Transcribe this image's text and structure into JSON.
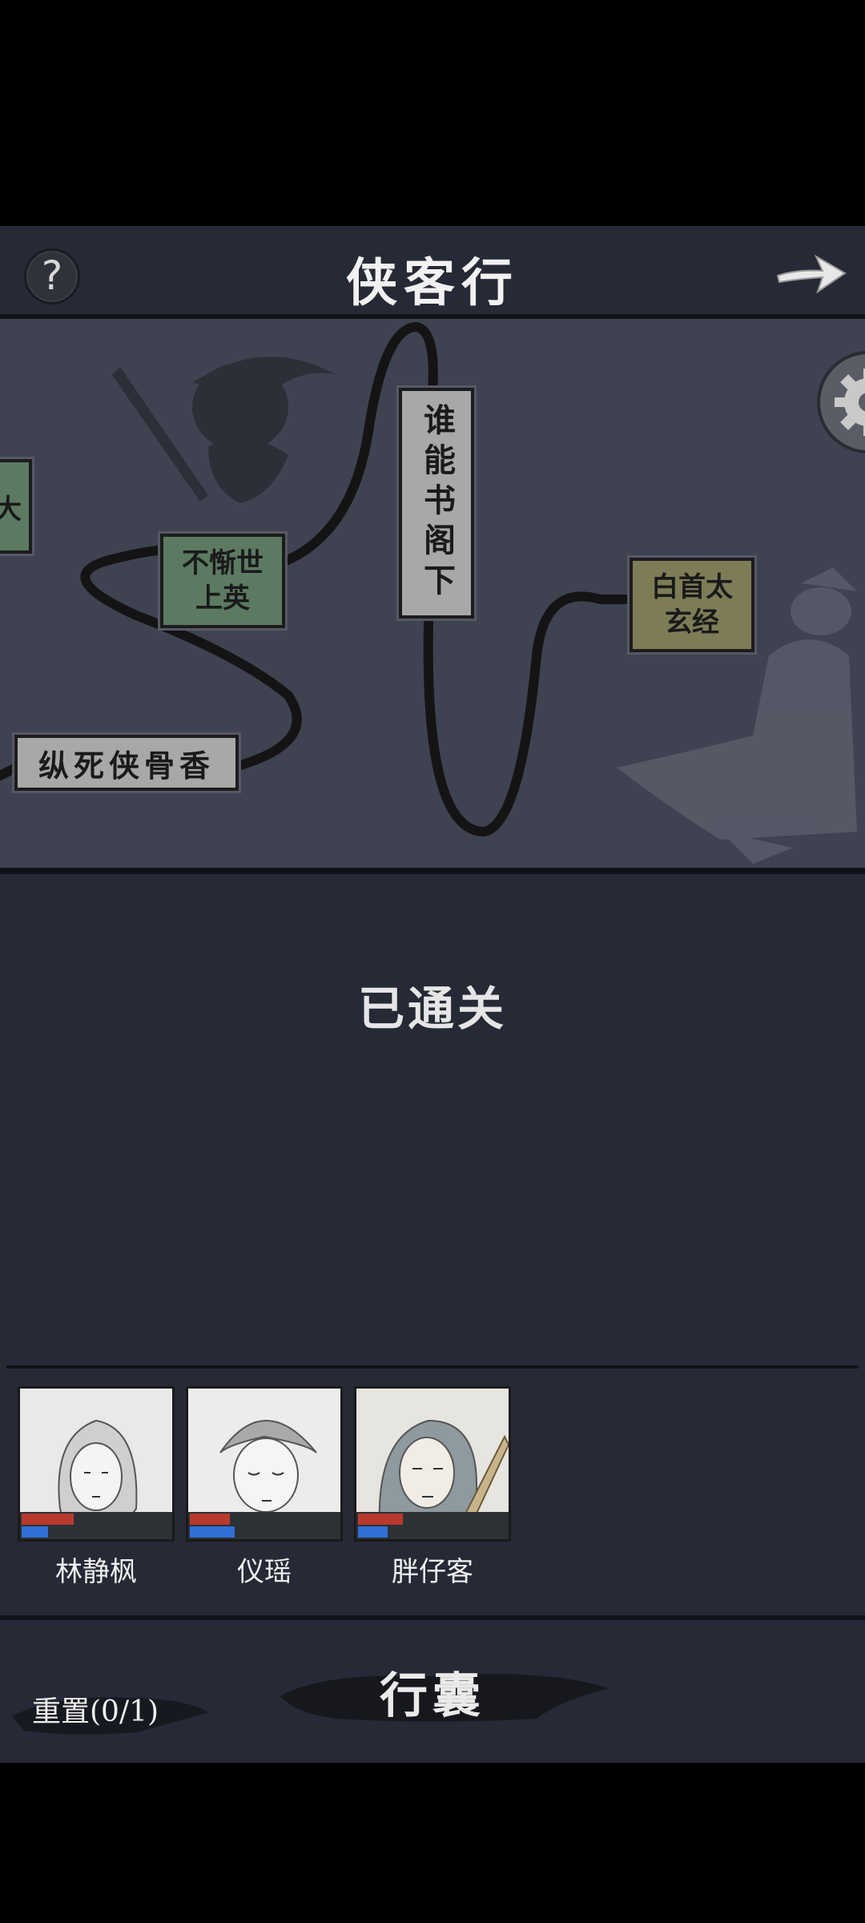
{
  "header": {
    "help_label": "?",
    "title": "侠客行"
  },
  "map": {
    "nodes": [
      {
        "label": "大",
        "color": "green"
      },
      {
        "label": "不惭世上英",
        "line1": "不惭世",
        "line2": "上英",
        "color": "green"
      },
      {
        "label": "谁能书阁下",
        "color": "gray"
      },
      {
        "label": "白首太玄经",
        "line1": "白首太",
        "line2": "玄经",
        "color": "olive"
      },
      {
        "label": "纵死侠骨香",
        "color": "gray"
      }
    ]
  },
  "status_text": "已通关",
  "party": [
    {
      "name": "林静枫",
      "hp": 0.35,
      "mp": 0.18
    },
    {
      "name": "仪瑶",
      "hp": 0.27,
      "mp": 0.3
    },
    {
      "name": "胖仔客",
      "hp": 0.3,
      "mp": 0.2
    }
  ],
  "bottom": {
    "bag_label": "行囊",
    "reset_label": "重置(0/1)"
  },
  "colors": {
    "background": "#262936",
    "map_background": "#3f4250",
    "node_green": "#5c7a62",
    "node_gray": "#a8a8a8",
    "node_olive": "#7d7c57",
    "hp_bar": "#b83a2d",
    "mp_bar": "#2f6fd6"
  }
}
